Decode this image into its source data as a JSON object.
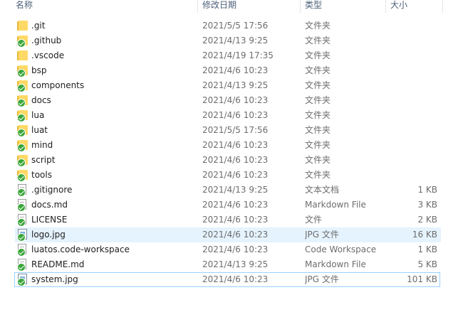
{
  "columns": {
    "name": "名称",
    "date": "修改日期",
    "type": "类型",
    "size": "大小"
  },
  "items": [
    {
      "name": ".git",
      "date": "2021/5/5 17:56",
      "type": "文件夹",
      "size": "",
      "icon": "folder-icon",
      "synced": false
    },
    {
      "name": ".github",
      "date": "2021/4/13 9:25",
      "type": "文件夹",
      "size": "",
      "icon": "folder-icon",
      "synced": true
    },
    {
      "name": ".vscode",
      "date": "2021/4/19 17:35",
      "type": "文件夹",
      "size": "",
      "icon": "folder-icon",
      "synced": false
    },
    {
      "name": "bsp",
      "date": "2021/4/6 10:23",
      "type": "文件夹",
      "size": "",
      "icon": "folder-icon",
      "synced": true
    },
    {
      "name": "components",
      "date": "2021/4/13 9:25",
      "type": "文件夹",
      "size": "",
      "icon": "folder-icon",
      "synced": true
    },
    {
      "name": "docs",
      "date": "2021/4/6 10:23",
      "type": "文件夹",
      "size": "",
      "icon": "folder-icon",
      "synced": true
    },
    {
      "name": "lua",
      "date": "2021/4/6 10:23",
      "type": "文件夹",
      "size": "",
      "icon": "folder-icon",
      "synced": true
    },
    {
      "name": "luat",
      "date": "2021/5/5 17:56",
      "type": "文件夹",
      "size": "",
      "icon": "folder-icon",
      "synced": true
    },
    {
      "name": "mind",
      "date": "2021/4/6 10:23",
      "type": "文件夹",
      "size": "",
      "icon": "folder-icon",
      "synced": true
    },
    {
      "name": "script",
      "date": "2021/4/6 10:23",
      "type": "文件夹",
      "size": "",
      "icon": "folder-icon",
      "synced": true
    },
    {
      "name": "tools",
      "date": "2021/4/6 10:23",
      "type": "文件夹",
      "size": "",
      "icon": "folder-icon",
      "synced": true
    },
    {
      "name": ".gitignore",
      "date": "2021/4/13 9:25",
      "type": "文本文档",
      "size": "1 KB",
      "icon": "file-icon",
      "synced": true
    },
    {
      "name": "docs.md",
      "date": "2021/4/6 10:23",
      "type": "Markdown File",
      "size": "3 KB",
      "icon": "file-icon",
      "synced": true
    },
    {
      "name": "LICENSE",
      "date": "2021/4/6 10:23",
      "type": "文件",
      "size": "2 KB",
      "icon": "file-icon",
      "synced": true
    },
    {
      "name": "logo.jpg",
      "date": "2021/4/6 10:23",
      "type": "JPG 文件",
      "size": "16 KB",
      "icon": "image-icon",
      "synced": true
    },
    {
      "name": "luatos.code-workspace",
      "date": "2021/4/6 10:23",
      "type": "Code Workspace",
      "size": "1 KB",
      "icon": "file-icon",
      "synced": true
    },
    {
      "name": "README.md",
      "date": "2021/4/13 9:25",
      "type": "Markdown File",
      "size": "5 KB",
      "icon": "file-icon",
      "synced": true
    },
    {
      "name": "system.jpg",
      "date": "2021/4/6 10:23",
      "type": "JPG 文件",
      "size": "101 KB",
      "icon": "image-icon",
      "synced": true
    }
  ],
  "highlight": {
    "hover_index": 14,
    "selected_index": 17
  },
  "colors": {
    "hover": "#e5f3ff",
    "selected_border": "#99d1ff",
    "folder": "#ffd966",
    "sync_badge": "#3aa63a",
    "header_text": "#4c607a",
    "secondary_text": "#6d6d6d"
  }
}
